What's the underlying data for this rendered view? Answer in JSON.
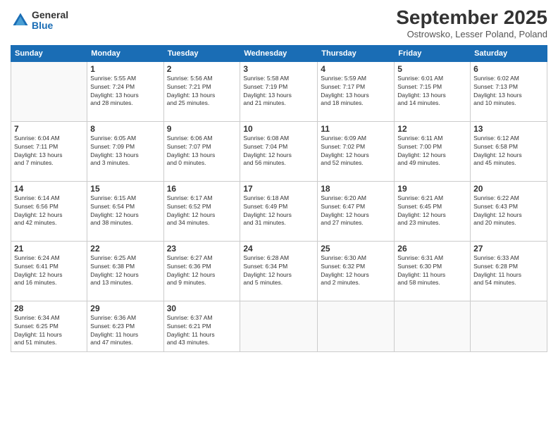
{
  "logo": {
    "general": "General",
    "blue": "Blue"
  },
  "header": {
    "title": "September 2025",
    "location": "Ostrowsko, Lesser Poland, Poland"
  },
  "days_of_week": [
    "Sunday",
    "Monday",
    "Tuesday",
    "Wednesday",
    "Thursday",
    "Friday",
    "Saturday"
  ],
  "weeks": [
    [
      {
        "day": "",
        "info": ""
      },
      {
        "day": "1",
        "info": "Sunrise: 5:55 AM\nSunset: 7:24 PM\nDaylight: 13 hours\nand 28 minutes."
      },
      {
        "day": "2",
        "info": "Sunrise: 5:56 AM\nSunset: 7:21 PM\nDaylight: 13 hours\nand 25 minutes."
      },
      {
        "day": "3",
        "info": "Sunrise: 5:58 AM\nSunset: 7:19 PM\nDaylight: 13 hours\nand 21 minutes."
      },
      {
        "day": "4",
        "info": "Sunrise: 5:59 AM\nSunset: 7:17 PM\nDaylight: 13 hours\nand 18 minutes."
      },
      {
        "day": "5",
        "info": "Sunrise: 6:01 AM\nSunset: 7:15 PM\nDaylight: 13 hours\nand 14 minutes."
      },
      {
        "day": "6",
        "info": "Sunrise: 6:02 AM\nSunset: 7:13 PM\nDaylight: 13 hours\nand 10 minutes."
      }
    ],
    [
      {
        "day": "7",
        "info": "Sunrise: 6:04 AM\nSunset: 7:11 PM\nDaylight: 13 hours\nand 7 minutes."
      },
      {
        "day": "8",
        "info": "Sunrise: 6:05 AM\nSunset: 7:09 PM\nDaylight: 13 hours\nand 3 minutes."
      },
      {
        "day": "9",
        "info": "Sunrise: 6:06 AM\nSunset: 7:07 PM\nDaylight: 13 hours\nand 0 minutes."
      },
      {
        "day": "10",
        "info": "Sunrise: 6:08 AM\nSunset: 7:04 PM\nDaylight: 12 hours\nand 56 minutes."
      },
      {
        "day": "11",
        "info": "Sunrise: 6:09 AM\nSunset: 7:02 PM\nDaylight: 12 hours\nand 52 minutes."
      },
      {
        "day": "12",
        "info": "Sunrise: 6:11 AM\nSunset: 7:00 PM\nDaylight: 12 hours\nand 49 minutes."
      },
      {
        "day": "13",
        "info": "Sunrise: 6:12 AM\nSunset: 6:58 PM\nDaylight: 12 hours\nand 45 minutes."
      }
    ],
    [
      {
        "day": "14",
        "info": "Sunrise: 6:14 AM\nSunset: 6:56 PM\nDaylight: 12 hours\nand 42 minutes."
      },
      {
        "day": "15",
        "info": "Sunrise: 6:15 AM\nSunset: 6:54 PM\nDaylight: 12 hours\nand 38 minutes."
      },
      {
        "day": "16",
        "info": "Sunrise: 6:17 AM\nSunset: 6:52 PM\nDaylight: 12 hours\nand 34 minutes."
      },
      {
        "day": "17",
        "info": "Sunrise: 6:18 AM\nSunset: 6:49 PM\nDaylight: 12 hours\nand 31 minutes."
      },
      {
        "day": "18",
        "info": "Sunrise: 6:20 AM\nSunset: 6:47 PM\nDaylight: 12 hours\nand 27 minutes."
      },
      {
        "day": "19",
        "info": "Sunrise: 6:21 AM\nSunset: 6:45 PM\nDaylight: 12 hours\nand 23 minutes."
      },
      {
        "day": "20",
        "info": "Sunrise: 6:22 AM\nSunset: 6:43 PM\nDaylight: 12 hours\nand 20 minutes."
      }
    ],
    [
      {
        "day": "21",
        "info": "Sunrise: 6:24 AM\nSunset: 6:41 PM\nDaylight: 12 hours\nand 16 minutes."
      },
      {
        "day": "22",
        "info": "Sunrise: 6:25 AM\nSunset: 6:38 PM\nDaylight: 12 hours\nand 13 minutes."
      },
      {
        "day": "23",
        "info": "Sunrise: 6:27 AM\nSunset: 6:36 PM\nDaylight: 12 hours\nand 9 minutes."
      },
      {
        "day": "24",
        "info": "Sunrise: 6:28 AM\nSunset: 6:34 PM\nDaylight: 12 hours\nand 5 minutes."
      },
      {
        "day": "25",
        "info": "Sunrise: 6:30 AM\nSunset: 6:32 PM\nDaylight: 12 hours\nand 2 minutes."
      },
      {
        "day": "26",
        "info": "Sunrise: 6:31 AM\nSunset: 6:30 PM\nDaylight: 11 hours\nand 58 minutes."
      },
      {
        "day": "27",
        "info": "Sunrise: 6:33 AM\nSunset: 6:28 PM\nDaylight: 11 hours\nand 54 minutes."
      }
    ],
    [
      {
        "day": "28",
        "info": "Sunrise: 6:34 AM\nSunset: 6:25 PM\nDaylight: 11 hours\nand 51 minutes."
      },
      {
        "day": "29",
        "info": "Sunrise: 6:36 AM\nSunset: 6:23 PM\nDaylight: 11 hours\nand 47 minutes."
      },
      {
        "day": "30",
        "info": "Sunrise: 6:37 AM\nSunset: 6:21 PM\nDaylight: 11 hours\nand 43 minutes."
      },
      {
        "day": "",
        "info": ""
      },
      {
        "day": "",
        "info": ""
      },
      {
        "day": "",
        "info": ""
      },
      {
        "day": "",
        "info": ""
      }
    ]
  ]
}
